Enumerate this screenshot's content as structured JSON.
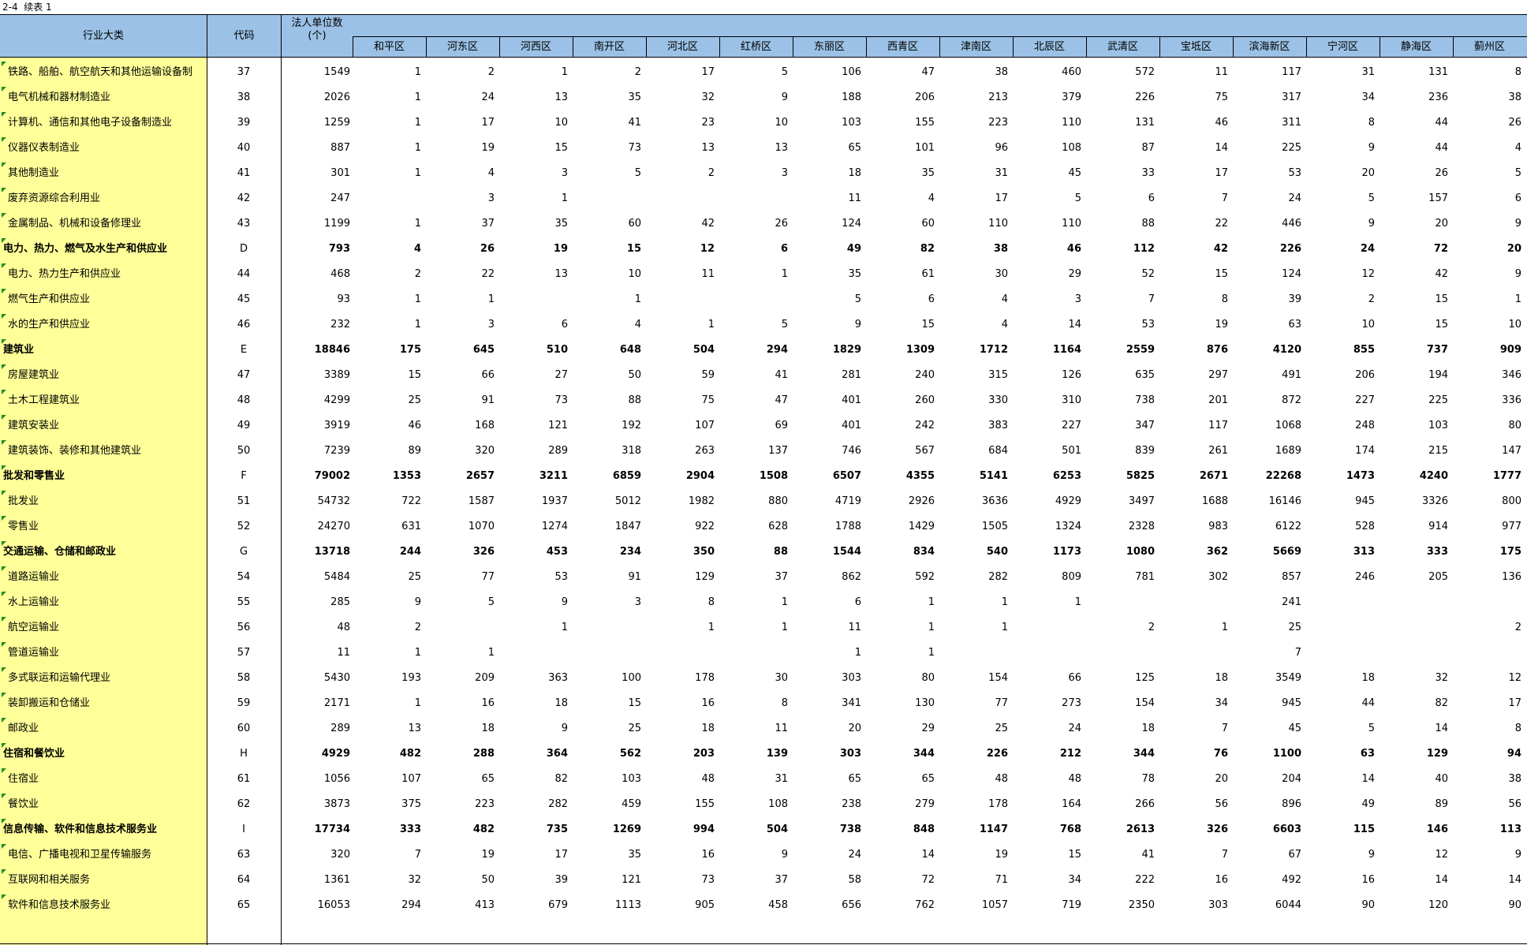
{
  "sheet": {
    "title": "2-4  续表 1"
  },
  "header": {
    "industry": "行业大类",
    "code": "代码",
    "total_line1": "法人单位数",
    "total_line2": "(个)",
    "districts": [
      "和平区",
      "河东区",
      "河西区",
      "南开区",
      "河北区",
      "红桥区",
      "东丽区",
      "西青区",
      "津南区",
      "北辰区",
      "武清区",
      "宝坻区",
      "滨海新区",
      "宁河区",
      "静海区",
      "蓟州区"
    ]
  },
  "colors": {
    "header_bg": "#9bc2e6",
    "left_bg": "#ffff99",
    "comment_marker": "#1f8f1f"
  },
  "rows": [
    {
      "name": "铁路、船舶、航空航天和其他运输设备制",
      "code": "37",
      "bold": false,
      "sub": true,
      "total": "1549",
      "v": [
        "1",
        "2",
        "1",
        "2",
        "17",
        "5",
        "106",
        "47",
        "38",
        "460",
        "572",
        "11",
        "117",
        "31",
        "131",
        "8"
      ]
    },
    {
      "name": "电气机械和器材制造业",
      "code": "38",
      "bold": false,
      "sub": true,
      "total": "2026",
      "v": [
        "1",
        "24",
        "13",
        "35",
        "32",
        "9",
        "188",
        "206",
        "213",
        "379",
        "226",
        "75",
        "317",
        "34",
        "236",
        "38"
      ]
    },
    {
      "name": "计算机、通信和其他电子设备制造业",
      "code": "39",
      "bold": false,
      "sub": true,
      "total": "1259",
      "v": [
        "1",
        "17",
        "10",
        "41",
        "23",
        "10",
        "103",
        "155",
        "223",
        "110",
        "131",
        "46",
        "311",
        "8",
        "44",
        "26"
      ]
    },
    {
      "name": "仪器仪表制造业",
      "code": "40",
      "bold": false,
      "sub": true,
      "total": "887",
      "v": [
        "1",
        "19",
        "15",
        "73",
        "13",
        "13",
        "65",
        "101",
        "96",
        "108",
        "87",
        "14",
        "225",
        "9",
        "44",
        "4"
      ]
    },
    {
      "name": "其他制造业",
      "code": "41",
      "bold": false,
      "sub": true,
      "total": "301",
      "v": [
        "1",
        "4",
        "3",
        "5",
        "2",
        "3",
        "18",
        "35",
        "31",
        "45",
        "33",
        "17",
        "53",
        "20",
        "26",
        "5"
      ]
    },
    {
      "name": "废弃资源综合利用业",
      "code": "42",
      "bold": false,
      "sub": true,
      "total": "247",
      "v": [
        "",
        "3",
        "1",
        "",
        "",
        "",
        "11",
        "4",
        "17",
        "5",
        "6",
        "7",
        "24",
        "5",
        "157",
        "6"
      ]
    },
    {
      "name": "金属制品、机械和设备修理业",
      "code": "43",
      "bold": false,
      "sub": true,
      "total": "1199",
      "v": [
        "1",
        "37",
        "35",
        "60",
        "42",
        "26",
        "124",
        "60",
        "110",
        "110",
        "88",
        "22",
        "446",
        "9",
        "20",
        "9"
      ]
    },
    {
      "name": "电力、热力、燃气及水生产和供应业",
      "code": "D",
      "bold": true,
      "sub": false,
      "total": "793",
      "v": [
        "4",
        "26",
        "19",
        "15",
        "12",
        "6",
        "49",
        "82",
        "38",
        "46",
        "112",
        "42",
        "226",
        "24",
        "72",
        "20"
      ]
    },
    {
      "name": "电力、热力生产和供应业",
      "code": "44",
      "bold": false,
      "sub": true,
      "total": "468",
      "v": [
        "2",
        "22",
        "13",
        "10",
        "11",
        "1",
        "35",
        "61",
        "30",
        "29",
        "52",
        "15",
        "124",
        "12",
        "42",
        "9"
      ]
    },
    {
      "name": "燃气生产和供应业",
      "code": "45",
      "bold": false,
      "sub": true,
      "total": "93",
      "v": [
        "1",
        "1",
        "",
        "1",
        "",
        "",
        "5",
        "6",
        "4",
        "3",
        "7",
        "8",
        "39",
        "2",
        "15",
        "1"
      ]
    },
    {
      "name": "水的生产和供应业",
      "code": "46",
      "bold": false,
      "sub": true,
      "total": "232",
      "v": [
        "1",
        "3",
        "6",
        "4",
        "1",
        "5",
        "9",
        "15",
        "4",
        "14",
        "53",
        "19",
        "63",
        "10",
        "15",
        "10"
      ]
    },
    {
      "name": "建筑业",
      "code": "E",
      "bold": true,
      "sub": false,
      "total": "18846",
      "v": [
        "175",
        "645",
        "510",
        "648",
        "504",
        "294",
        "1829",
        "1309",
        "1712",
        "1164",
        "2559",
        "876",
        "4120",
        "855",
        "737",
        "909"
      ]
    },
    {
      "name": "房屋建筑业",
      "code": "47",
      "bold": false,
      "sub": true,
      "total": "3389",
      "v": [
        "15",
        "66",
        "27",
        "50",
        "59",
        "41",
        "281",
        "240",
        "315",
        "126",
        "635",
        "297",
        "491",
        "206",
        "194",
        "346"
      ]
    },
    {
      "name": "土木工程建筑业",
      "code": "48",
      "bold": false,
      "sub": true,
      "total": "4299",
      "v": [
        "25",
        "91",
        "73",
        "88",
        "75",
        "47",
        "401",
        "260",
        "330",
        "310",
        "738",
        "201",
        "872",
        "227",
        "225",
        "336"
      ]
    },
    {
      "name": "建筑安装业",
      "code": "49",
      "bold": false,
      "sub": true,
      "total": "3919",
      "v": [
        "46",
        "168",
        "121",
        "192",
        "107",
        "69",
        "401",
        "242",
        "383",
        "227",
        "347",
        "117",
        "1068",
        "248",
        "103",
        "80"
      ]
    },
    {
      "name": "建筑装饰、装修和其他建筑业",
      "code": "50",
      "bold": false,
      "sub": true,
      "total": "7239",
      "v": [
        "89",
        "320",
        "289",
        "318",
        "263",
        "137",
        "746",
        "567",
        "684",
        "501",
        "839",
        "261",
        "1689",
        "174",
        "215",
        "147"
      ]
    },
    {
      "name": "批发和零售业",
      "code": "F",
      "bold": true,
      "sub": false,
      "total": "79002",
      "v": [
        "1353",
        "2657",
        "3211",
        "6859",
        "2904",
        "1508",
        "6507",
        "4355",
        "5141",
        "6253",
        "5825",
        "2671",
        "22268",
        "1473",
        "4240",
        "1777"
      ]
    },
    {
      "name": "批发业",
      "code": "51",
      "bold": false,
      "sub": true,
      "total": "54732",
      "v": [
        "722",
        "1587",
        "1937",
        "5012",
        "1982",
        "880",
        "4719",
        "2926",
        "3636",
        "4929",
        "3497",
        "1688",
        "16146",
        "945",
        "3326",
        "800"
      ]
    },
    {
      "name": "零售业",
      "code": "52",
      "bold": false,
      "sub": true,
      "total": "24270",
      "v": [
        "631",
        "1070",
        "1274",
        "1847",
        "922",
        "628",
        "1788",
        "1429",
        "1505",
        "1324",
        "2328",
        "983",
        "6122",
        "528",
        "914",
        "977"
      ]
    },
    {
      "name": "交通运输、仓储和邮政业",
      "code": "G",
      "bold": true,
      "sub": false,
      "total": "13718",
      "v": [
        "244",
        "326",
        "453",
        "234",
        "350",
        "88",
        "1544",
        "834",
        "540",
        "1173",
        "1080",
        "362",
        "5669",
        "313",
        "333",
        "175"
      ]
    },
    {
      "name": "道路运输业",
      "code": "54",
      "bold": false,
      "sub": true,
      "total": "5484",
      "v": [
        "25",
        "77",
        "53",
        "91",
        "129",
        "37",
        "862",
        "592",
        "282",
        "809",
        "781",
        "302",
        "857",
        "246",
        "205",
        "136"
      ]
    },
    {
      "name": "水上运输业",
      "code": "55",
      "bold": false,
      "sub": true,
      "total": "285",
      "v": [
        "9",
        "5",
        "9",
        "3",
        "8",
        "1",
        "6",
        "1",
        "1",
        "1",
        "",
        "",
        "241",
        "",
        "",
        ""
      ]
    },
    {
      "name": "航空运输业",
      "code": "56",
      "bold": false,
      "sub": true,
      "total": "48",
      "v": [
        "2",
        "",
        "1",
        "",
        "1",
        "1",
        "11",
        "1",
        "1",
        "",
        "2",
        "1",
        "25",
        "",
        "",
        "2"
      ]
    },
    {
      "name": "管道运输业",
      "code": "57",
      "bold": false,
      "sub": true,
      "total": "11",
      "v": [
        "1",
        "1",
        "",
        "",
        "",
        "",
        "1",
        "1",
        "",
        "",
        "",
        "",
        "7",
        "",
        "",
        ""
      ]
    },
    {
      "name": "多式联运和运输代理业",
      "code": "58",
      "bold": false,
      "sub": true,
      "total": "5430",
      "v": [
        "193",
        "209",
        "363",
        "100",
        "178",
        "30",
        "303",
        "80",
        "154",
        "66",
        "125",
        "18",
        "3549",
        "18",
        "32",
        "12"
      ]
    },
    {
      "name": "装卸搬运和仓储业",
      "code": "59",
      "bold": false,
      "sub": true,
      "total": "2171",
      "v": [
        "1",
        "16",
        "18",
        "15",
        "16",
        "8",
        "341",
        "130",
        "77",
        "273",
        "154",
        "34",
        "945",
        "44",
        "82",
        "17"
      ]
    },
    {
      "name": "邮政业",
      "code": "60",
      "bold": false,
      "sub": true,
      "total": "289",
      "v": [
        "13",
        "18",
        "9",
        "25",
        "18",
        "11",
        "20",
        "29",
        "25",
        "24",
        "18",
        "7",
        "45",
        "5",
        "14",
        "8"
      ]
    },
    {
      "name": "住宿和餐饮业",
      "code": "H",
      "bold": true,
      "sub": false,
      "total": "4929",
      "v": [
        "482",
        "288",
        "364",
        "562",
        "203",
        "139",
        "303",
        "344",
        "226",
        "212",
        "344",
        "76",
        "1100",
        "63",
        "129",
        "94"
      ]
    },
    {
      "name": "住宿业",
      "code": "61",
      "bold": false,
      "sub": true,
      "total": "1056",
      "v": [
        "107",
        "65",
        "82",
        "103",
        "48",
        "31",
        "65",
        "65",
        "48",
        "48",
        "78",
        "20",
        "204",
        "14",
        "40",
        "38"
      ]
    },
    {
      "name": "餐饮业",
      "code": "62",
      "bold": false,
      "sub": true,
      "total": "3873",
      "v": [
        "375",
        "223",
        "282",
        "459",
        "155",
        "108",
        "238",
        "279",
        "178",
        "164",
        "266",
        "56",
        "896",
        "49",
        "89",
        "56"
      ]
    },
    {
      "name": "信息传输、软件和信息技术服务业",
      "code": "I",
      "bold": true,
      "sub": false,
      "total": "17734",
      "v": [
        "333",
        "482",
        "735",
        "1269",
        "994",
        "504",
        "738",
        "848",
        "1147",
        "768",
        "2613",
        "326",
        "6603",
        "115",
        "146",
        "113"
      ]
    },
    {
      "name": "电信、广播电视和卫星传输服务",
      "code": "63",
      "bold": false,
      "sub": true,
      "total": "320",
      "v": [
        "7",
        "19",
        "17",
        "35",
        "16",
        "9",
        "24",
        "14",
        "19",
        "15",
        "41",
        "7",
        "67",
        "9",
        "12",
        "9"
      ]
    },
    {
      "name": "互联网和相关服务",
      "code": "64",
      "bold": false,
      "sub": true,
      "total": "1361",
      "v": [
        "32",
        "50",
        "39",
        "121",
        "73",
        "37",
        "58",
        "72",
        "71",
        "34",
        "222",
        "16",
        "492",
        "16",
        "14",
        "14"
      ]
    },
    {
      "name": "软件和信息技术服务业",
      "code": "65",
      "bold": false,
      "sub": true,
      "total": "16053",
      "v": [
        "294",
        "413",
        "679",
        "1113",
        "905",
        "458",
        "656",
        "762",
        "1057",
        "719",
        "2350",
        "303",
        "6044",
        "90",
        "120",
        "90"
      ]
    }
  ]
}
